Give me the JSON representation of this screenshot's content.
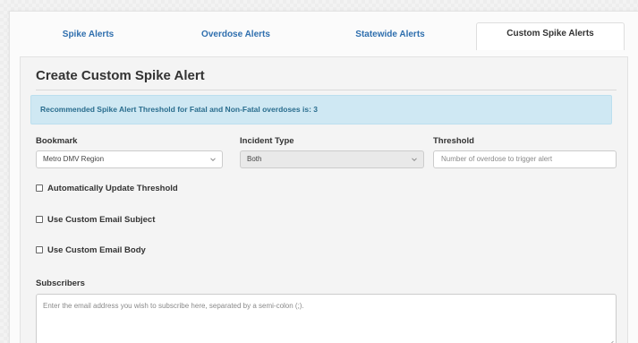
{
  "tabs": [
    {
      "label": "Spike Alerts"
    },
    {
      "label": "Overdose Alerts"
    },
    {
      "label": "Statewide Alerts"
    },
    {
      "label": "Custom Spike Alerts"
    }
  ],
  "panel": {
    "title": "Create Custom Spike Alert",
    "info_text": "Recommended Spike Alert Threshold for Fatal and Non-Fatal overdoses is: 3"
  },
  "form": {
    "bookmark_label": "Bookmark",
    "bookmark_value": "Metro DMV Region",
    "incident_type_label": "Incident Type",
    "incident_type_value": "Both",
    "threshold_label": "Threshold",
    "threshold_placeholder": "Number of overdose to trigger alert",
    "auto_update_label": "Automatically Update Threshold",
    "custom_subject_label": "Use Custom Email Subject",
    "custom_body_label": "Use Custom Email Body",
    "subscribers_label": "Subscribers",
    "subscribers_placeholder": "Enter the email address you wish to subscribe here, separated by a semi-colon (;)."
  },
  "colors": {
    "tab_link": "#2f6fae",
    "info_bg": "#cfe8f3",
    "info_text": "#2a6d8e"
  },
  "icons": {
    "select_chevron": "chevron-down-icon",
    "resize_handle": "resize-grip-icon"
  }
}
